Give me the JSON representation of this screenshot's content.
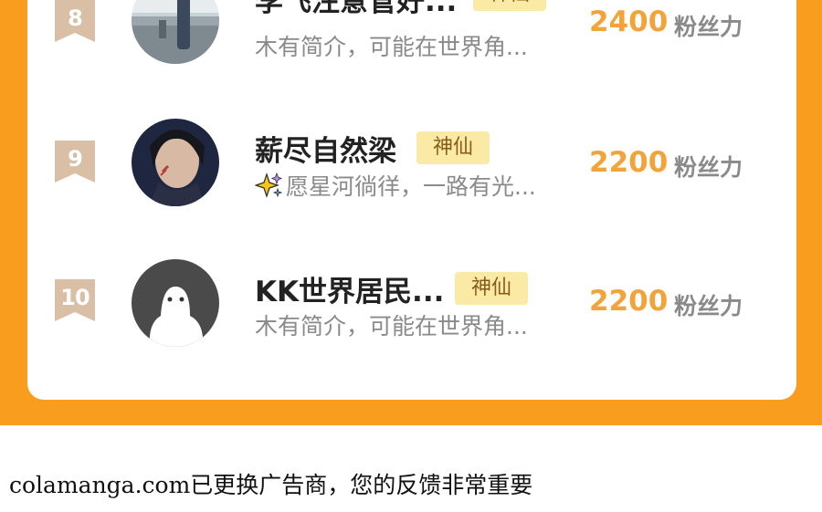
{
  "ranking": {
    "rows": [
      {
        "rank": "8",
        "name": "李飞注意管好...",
        "tag": "神仙",
        "bio": "木有简介，可能在世界角...",
        "score": "2400",
        "score_unit": "粉丝力",
        "avatar": "photo-avatar-person-outdoor"
      },
      {
        "rank": "9",
        "name": "薪尽自然梁",
        "tag": "神仙",
        "bio_icon": "sparkle-icon",
        "bio": "愿星河徜徉，一路有光...",
        "score": "2200",
        "score_unit": "粉丝力",
        "avatar": "photo-avatar-character"
      },
      {
        "rank": "10",
        "name": "KK世界居民...",
        "tag": "神仙",
        "bio": "木有简介，可能在世界角...",
        "score": "2200",
        "score_unit": "粉丝力",
        "avatar": "default-avatar-icon"
      }
    ]
  },
  "footer": {
    "notice": "colamanga.com已更换广告商，您的反馈非常重要"
  },
  "colors": {
    "frame": "#f99d1f",
    "score": "#f2a33a",
    "tag_bg": "#fbe9a6",
    "badge": "#d9bfa5"
  }
}
